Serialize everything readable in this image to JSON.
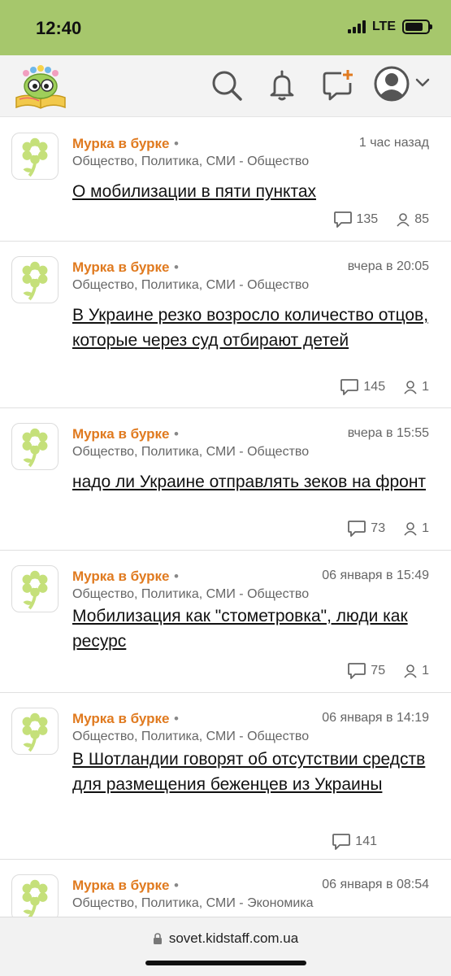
{
  "status_bar": {
    "time": "12:40",
    "network": "LTE",
    "background": "#a6c76c"
  },
  "header": {
    "icons": [
      "logo-owl-book",
      "search-icon",
      "bell-icon",
      "compose-icon",
      "user-avatar-icon",
      "chevron-down-icon"
    ]
  },
  "posts": [
    {
      "author": "Мурка в бурке",
      "dot": "•",
      "time": "1 час назад",
      "category": "Общество, Политика, СМИ - Общество",
      "title": "О мобилизации в пяти пунктах",
      "comments": "135",
      "participants": "85"
    },
    {
      "author": "Мурка в бурке",
      "dot": "•",
      "time": "вчера в 20:05",
      "category": "Общество, Политика, СМИ - Общество",
      "title": "В Украине резко возросло количество отцов, которые через суд отбирают детей",
      "comments": "145",
      "participants": "1"
    },
    {
      "author": "Мурка в бурке",
      "dot": "•",
      "time": "вчера в 15:55",
      "category": "Общество, Политика, СМИ - Общество",
      "title": "надо ли Украине отправлять зеков на фронт",
      "comments": "73",
      "participants": "1"
    },
    {
      "author": "Мурка в бурке",
      "dot": "•",
      "time": "06 января в 15:49",
      "category": "Общество, Политика, СМИ - Общество",
      "title": "Мобилизация как \"стометровка\", люди как ресурс",
      "comments": "75",
      "participants": "1"
    },
    {
      "author": "Мурка в бурке",
      "dot": "•",
      "time": "06 января в 14:19",
      "category": "Общество, Политика, СМИ - Общество",
      "title": "В Шотландии говорят об отсутствии средств для размещения беженцев из Украины",
      "comments": "141"
    },
    {
      "author": "Мурка в бурке",
      "dot": "•",
      "time": "06 января в 08:54",
      "category": "Общество, Политика, СМИ - Экономика"
    }
  ],
  "browser": {
    "url": "sovet.kidstaff.com.ua"
  },
  "colors": {
    "accent": "#e07a1f",
    "header_bg": "#f3f3f3",
    "flower": "#c5e07a"
  }
}
